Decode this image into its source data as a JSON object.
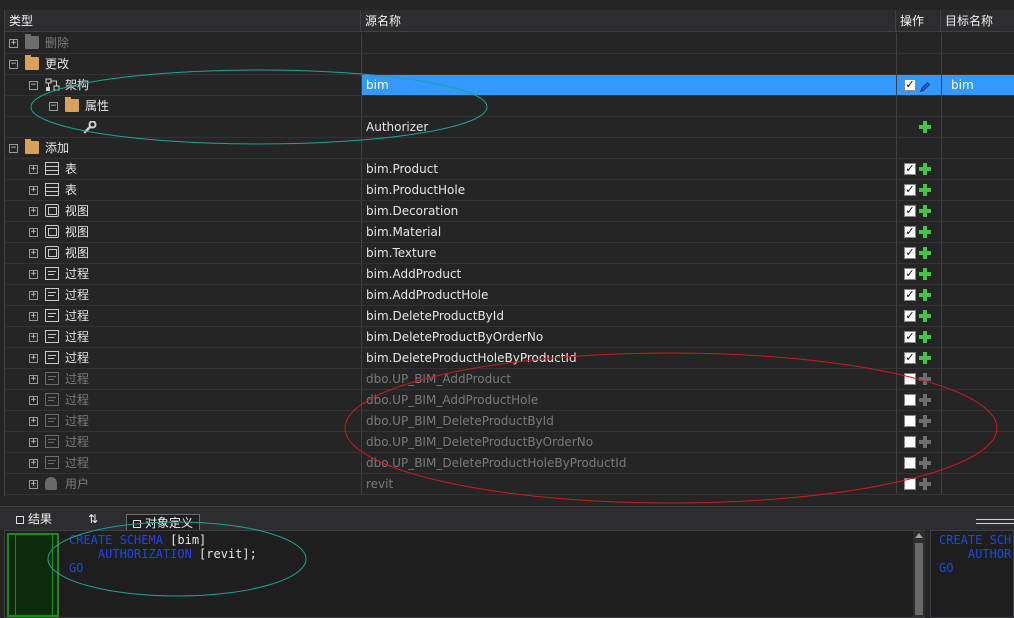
{
  "grid": {
    "columns": {
      "type": "类型",
      "source": "源名称",
      "ops": "操作",
      "target": "目标名称"
    },
    "rows": [
      {
        "level": 0,
        "expander": "+",
        "icon": "folder-icon",
        "type": "删除",
        "source": "",
        "check": null,
        "action": null,
        "target": "",
        "dim": true
      },
      {
        "level": 0,
        "expander": "−",
        "icon": "folder-icon",
        "type": "更改",
        "source": "",
        "check": null,
        "action": null,
        "target": "",
        "dim": false
      },
      {
        "level": 1,
        "expander": "−",
        "icon": "schema-icon",
        "type": "架构",
        "source": "bim",
        "check": true,
        "action": "edit",
        "target": "bim",
        "selected": true
      },
      {
        "level": 2,
        "expander": "−",
        "icon": "folder-icon",
        "type": "属性",
        "source": "",
        "check": null,
        "action": null,
        "target": ""
      },
      {
        "level": 3,
        "expander": "",
        "icon": "wrench-icon",
        "type": "",
        "source": "Authorizer",
        "check": null,
        "action": "add",
        "target": ""
      },
      {
        "level": 0,
        "expander": "−",
        "icon": "folder-icon",
        "type": "添加",
        "source": "",
        "check": null,
        "action": null,
        "target": ""
      },
      {
        "level": 1,
        "expander": "+",
        "icon": "table-icon",
        "type": "表",
        "source": "bim.Product",
        "check": true,
        "action": "add",
        "target": ""
      },
      {
        "level": 1,
        "expander": "+",
        "icon": "table-icon",
        "type": "表",
        "source": "bim.ProductHole",
        "check": true,
        "action": "add",
        "target": ""
      },
      {
        "level": 1,
        "expander": "+",
        "icon": "view-icon",
        "type": "视图",
        "source": "bim.Decoration",
        "check": true,
        "action": "add",
        "target": ""
      },
      {
        "level": 1,
        "expander": "+",
        "icon": "view-icon",
        "type": "视图",
        "source": "bim.Material",
        "check": true,
        "action": "add",
        "target": ""
      },
      {
        "level": 1,
        "expander": "+",
        "icon": "view-icon",
        "type": "视图",
        "source": "bim.Texture",
        "check": true,
        "action": "add",
        "target": ""
      },
      {
        "level": 1,
        "expander": "+",
        "icon": "procedure-icon",
        "type": "过程",
        "source": "bim.AddProduct",
        "check": true,
        "action": "add",
        "target": ""
      },
      {
        "level": 1,
        "expander": "+",
        "icon": "procedure-icon",
        "type": "过程",
        "source": "bim.AddProductHole",
        "check": true,
        "action": "add",
        "target": ""
      },
      {
        "level": 1,
        "expander": "+",
        "icon": "procedure-icon",
        "type": "过程",
        "source": "bim.DeleteProductById",
        "check": true,
        "action": "add",
        "target": ""
      },
      {
        "level": 1,
        "expander": "+",
        "icon": "procedure-icon",
        "type": "过程",
        "source": "bim.DeleteProductByOrderNo",
        "check": true,
        "action": "add",
        "target": ""
      },
      {
        "level": 1,
        "expander": "+",
        "icon": "procedure-icon",
        "type": "过程",
        "source": "bim.DeleteProductHoleByProductId",
        "check": true,
        "action": "add",
        "target": ""
      },
      {
        "level": 1,
        "expander": "+",
        "icon": "procedure-icon",
        "type": "过程",
        "source": "dbo.UP_BIM_AddProduct",
        "check": false,
        "action": "add",
        "target": "",
        "dim": true
      },
      {
        "level": 1,
        "expander": "+",
        "icon": "procedure-icon",
        "type": "过程",
        "source": "dbo.UP_BIM_AddProductHole",
        "check": false,
        "action": "add",
        "target": "",
        "dim": true
      },
      {
        "level": 1,
        "expander": "+",
        "icon": "procedure-icon",
        "type": "过程",
        "source": "dbo.UP_BIM_DeleteProductById",
        "check": false,
        "action": "add",
        "target": "",
        "dim": true
      },
      {
        "level": 1,
        "expander": "+",
        "icon": "procedure-icon",
        "type": "过程",
        "source": "dbo.UP_BIM_DeleteProductByOrderNo",
        "check": false,
        "action": "add",
        "target": "",
        "dim": true
      },
      {
        "level": 1,
        "expander": "+",
        "icon": "procedure-icon",
        "type": "过程",
        "source": "dbo.UP_BIM_DeleteProductHoleByProductId",
        "check": false,
        "action": "add",
        "target": "",
        "dim": true
      },
      {
        "level": 1,
        "expander": "+",
        "icon": "user-icon",
        "type": "用户",
        "source": "revit",
        "check": false,
        "action": "add",
        "target": "",
        "dim": true
      }
    ]
  },
  "bottom": {
    "tabs": [
      {
        "label": "结果"
      },
      {
        "label": "⇅"
      },
      {
        "label": "对象定义"
      }
    ],
    "code": {
      "line1_kw": "CREATE SCHEMA",
      "line1_rest": " [bim]",
      "line2_kw": "    AUTHORIZATION",
      "line2_rest": " [revit];",
      "line3_kw": "GO"
    },
    "code_right": {
      "line1": "CREATE SCH",
      "line2": "    AUTHOR",
      "line3": "GO"
    }
  },
  "colors": {
    "selection": "#3399ff",
    "add": "#44c444",
    "keyword": "#1f48e0",
    "annotation_teal": "#1aa39a",
    "annotation_red": "#cc1c1c"
  }
}
